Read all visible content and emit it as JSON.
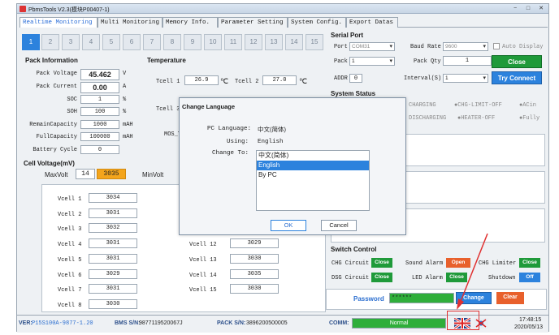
{
  "window": {
    "title": "PbmsTools V2.3(模块P00407-1)",
    "min": "−",
    "max": "□",
    "close": "✕"
  },
  "tabs": [
    "Realtime Monitoring",
    "Multi Monitoring",
    "Memory Info.",
    "Parameter Setting",
    "System Config.",
    "Export Datas"
  ],
  "packs": [
    "1",
    "2",
    "3",
    "4",
    "5",
    "6",
    "7",
    "8",
    "9",
    "10",
    "11",
    "12",
    "13",
    "14",
    "15"
  ],
  "pack_info": {
    "title": "Pack Information",
    "rows": [
      {
        "label": "Pack Voltage",
        "value": "45.462",
        "unit": "V"
      },
      {
        "label": "Pack Current",
        "value": "0.00",
        "unit": "A"
      },
      {
        "label": "SOC",
        "value": "1",
        "unit": "%"
      },
      {
        "label": "SOH",
        "value": "100",
        "unit": "%"
      },
      {
        "label": "RemainCapacity",
        "value": "1000",
        "unit": "mAH"
      },
      {
        "label": "FullCapacity",
        "value": "100000",
        "unit": "mAH"
      },
      {
        "label": "Battery Cycle",
        "value": "0",
        "unit": ""
      }
    ]
  },
  "temperature": {
    "title": "Temperature",
    "tcell1_label": "Tcell 1",
    "tcell1_value": "26.9",
    "tcell1_unit": "℃",
    "tcell2_label": "Tcell 2",
    "tcell2_value": "27.0",
    "tcell2_unit": "℃",
    "tcell3_label": "Tcell 3",
    "mos_label": "MOS_T"
  },
  "cell_voltage": {
    "title": "Cell Voltage(mV)",
    "maxvolt_label": "MaxVolt",
    "maxvolt_index": "14",
    "maxvolt_value": "3035",
    "minvolt_label": "MinVolt",
    "left": [
      {
        "label": "Vcell 1",
        "value": "3034"
      },
      {
        "label": "Vcell 2",
        "value": "3031"
      },
      {
        "label": "Vcell 3",
        "value": "3032"
      },
      {
        "label": "Vcell 4",
        "value": "3031"
      },
      {
        "label": "Vcell 5",
        "value": "3031"
      },
      {
        "label": "Vcell 6",
        "value": "3029"
      },
      {
        "label": "Vcell 7",
        "value": "3031"
      },
      {
        "label": "Vcell 8",
        "value": "3030"
      }
    ],
    "right": [
      {
        "label": "Vcell 12",
        "value": "3029"
      },
      {
        "label": "Vcell 13",
        "value": "3030"
      },
      {
        "label": "Vcell 14",
        "value": "3035"
      },
      {
        "label": "Vcell 15",
        "value": "3030"
      }
    ]
  },
  "serial": {
    "title": "Serial Port",
    "port_label": "Port",
    "port_value": "COM31",
    "baud_label": "Baud Rate",
    "baud_value": "9600",
    "auto_display": "Auto Display",
    "pack_label": "Pack",
    "pack_value": "1",
    "packqty_label": "Pack Qty",
    "packqty_value": "1",
    "close_label": "Close",
    "addr_label": "ADDR",
    "addr_value": "0",
    "interval_label": "Interval(S)",
    "interval_value": "1",
    "tryconnect_label": "Try Connect"
  },
  "system_status": {
    "title": "System Status",
    "items": [
      "CHARGING",
      "●CHG-LIMIT-OFF",
      "●ACin",
      "DISCHARGING",
      "●HEATER-OFF",
      "●Fully"
    ]
  },
  "switch_control": {
    "title": "Switch Control",
    "chg_circuit": "CHG Circuit",
    "chg_circuit_btn": "Close",
    "sound_alarm": "Sound Alarm",
    "sound_alarm_btn": "Open",
    "chg_limiter": "CHG Limiter",
    "chg_limiter_btn": "Close",
    "dsg_circuit": "DSG Circuit",
    "dsg_circuit_btn": "Close",
    "led_alarm": "LED Alarm",
    "led_alarm_btn": "Close",
    "shutdown": "Shutdown",
    "shutdown_btn": "Off"
  },
  "password": {
    "label": "Password",
    "value": "******",
    "change_btn": "Change",
    "clear_btn": "Clear"
  },
  "statusbar": {
    "ver_label": "VER:",
    "ver_value": "P15S100A-9877-1.20",
    "bms_label": "BMS S/N:",
    "bms_value": "9877119520067J",
    "pack_label": "PACK S/N:",
    "pack_value": "3896200500005",
    "comm_label": "COMM:",
    "comm_value": "Normal",
    "time": "17:48:15",
    "date": "2020/05/13"
  },
  "dialog": {
    "title": "Change Language",
    "pc_language_label": "PC Language:",
    "pc_language_value": "中文(简体)",
    "using_label": "Using:",
    "using_value": "English",
    "change_to_label": "Change To:",
    "options": [
      "中文(简体)",
      "English",
      "By PC"
    ],
    "selected": "English",
    "ok": "OK",
    "cancel": "Cancel"
  },
  "colors": {
    "accent": "#2c82dd",
    "green": "#1f9a3a",
    "orange": "#e8602c",
    "highlight": "#e03030"
  }
}
